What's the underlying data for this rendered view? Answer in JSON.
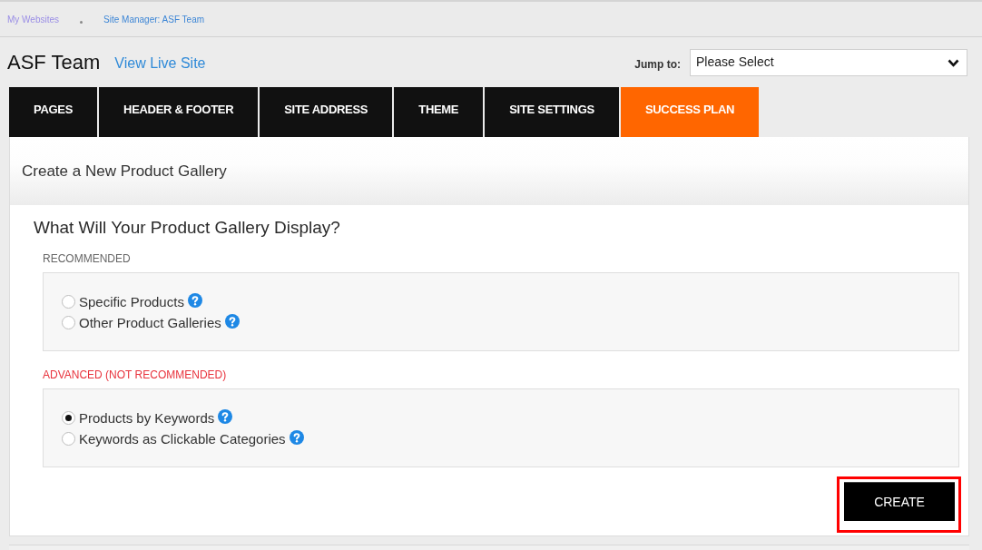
{
  "breadcrumb": [
    {
      "label": "My Websites",
      "visited": true
    },
    {
      "label": "Site Manager: ASF Team",
      "visited": false
    }
  ],
  "site": {
    "title": "ASF Team",
    "view_link": "View Live Site"
  },
  "jump_to": {
    "label": "Jump to:",
    "value": "Please Select"
  },
  "tabs": [
    {
      "label": "PAGES",
      "selected": false
    },
    {
      "label": "HEADER & FOOTER",
      "selected": false
    },
    {
      "label": "SITE ADDRESS",
      "selected": false
    },
    {
      "label": "THEME",
      "selected": false
    },
    {
      "label": "SITE SETTINGS",
      "selected": false
    },
    {
      "label": "SUCCESS PLAN",
      "selected": true
    }
  ],
  "panel": {
    "title": "Create a New Product Gallery",
    "question": "What Will Your Product Gallery Display?",
    "groups": [
      {
        "label": "RECOMMENDED",
        "kind": "normal",
        "options": [
          {
            "label": "Specific Products",
            "selected": false
          },
          {
            "label": "Other Product Galleries",
            "selected": false
          }
        ]
      },
      {
        "label": "ADVANCED (NOT RECOMMENDED)",
        "kind": "warning",
        "options": [
          {
            "label": "Products by Keywords",
            "selected": true
          },
          {
            "label": "Keywords as Clickable Categories",
            "selected": false
          }
        ]
      }
    ],
    "create_button": {
      "label": "CREATE",
      "highlighted": true
    }
  }
}
